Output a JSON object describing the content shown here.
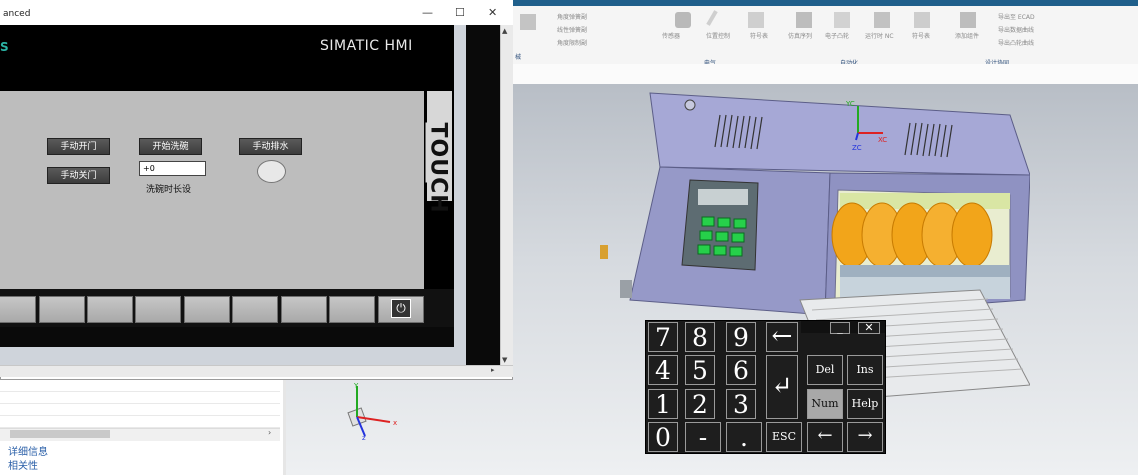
{
  "nx": {
    "ribbon_groups": [
      "电气",
      "自动化",
      "设计协同"
    ],
    "ribbon_left_fragment": "械",
    "electrical_items": [
      "传感器",
      "位置控制",
      "符号表"
    ],
    "automation_items": [
      "仿真序列",
      "电子凸轮",
      "运行时 NC",
      "符号表"
    ],
    "collab_items": [
      "添加组件",
      "导出至 ECAD",
      "导出数据曲线",
      "导出凸轮曲线"
    ],
    "spring_items": [
      "角度弹簧副",
      "线性弹簧副",
      "角度限制副"
    ],
    "nav_items": [
      "详细信息",
      "相关性"
    ],
    "triad_x_label": "x",
    "triad_y_label": "Y",
    "triad_z_label": "z",
    "part_triad": {
      "xc": "XC",
      "yc": "YC",
      "zc": "ZC"
    }
  },
  "hmi_window": {
    "title_fragment": "anced",
    "minimize": "—",
    "maximize": "☐",
    "close": "✕",
    "brand_logo": "S",
    "brand_name": "SIMATIC HMI",
    "touch_label": "TOUCH",
    "buttons": {
      "open_door": "手动开门",
      "close_door": "手动关门",
      "start_wash": "开始洗碗",
      "manual_drain": "手动排水"
    },
    "wash_time_value": "+0",
    "wash_time_label": "洗碗时长设",
    "power_symbol": "⏻"
  },
  "keypad": {
    "digits_row1": [
      "7",
      "8",
      "9"
    ],
    "digits_row2": [
      "4",
      "5",
      "6"
    ],
    "digits_row3": [
      "1",
      "2",
      "3"
    ],
    "zero": "0",
    "minus": "-",
    "dot": ".",
    "backspace": "←",
    "enter": "↵",
    "del": "Del",
    "ins": "Ins",
    "num": "Num",
    "help": "Help",
    "esc": "ESC",
    "left": "←",
    "right": "→",
    "win_min": "_",
    "win_close": "✕"
  },
  "colors": {
    "hmi_button": "#444444",
    "machine_body": "#9a9ccc",
    "machine_panel": "#5d6c72",
    "auger": "#f0a020",
    "keypad_bg": "#1a1a1a"
  }
}
